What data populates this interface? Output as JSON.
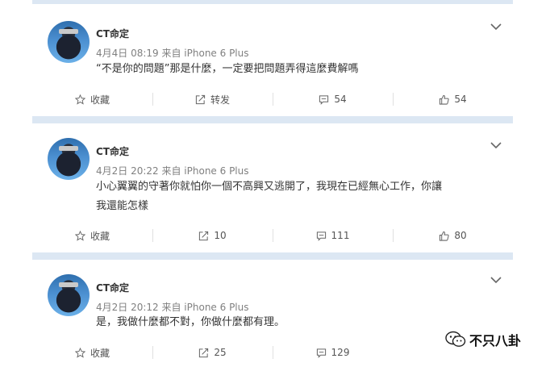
{
  "posts": [
    {
      "name": "CT命定",
      "time": "4月4日 08:19 来自 iPhone 6 Plus",
      "text": "“不是你的問題”那是什麼，一定要把問題弄得這麼費解嗎",
      "favorite_label": "收藏",
      "repost_label": "转发",
      "comment_count": "54",
      "like_count": "54"
    },
    {
      "name": "CT命定",
      "time": "4月2日 20:22 来自 iPhone 6 Plus",
      "text": "小心翼翼的守著你就怕你一個不高興又逃開了，我現在已經無心工作，你讓我還能怎樣",
      "favorite_label": "收藏",
      "repost_label": "10",
      "comment_count": "111",
      "like_count": "80"
    },
    {
      "name": "CT命定",
      "time": "4月2日 20:12 来自 iPhone 6 Plus",
      "text": "是，我做什麼都不對，你做什麼都有理。",
      "favorite_label": "收藏",
      "repost_label": "25",
      "comment_count": "129",
      "like_count": ""
    }
  ],
  "watermark": {
    "text": "不只八卦"
  },
  "colors": {
    "separator": "#dce7f3",
    "meta": "#808080",
    "text": "#333333"
  }
}
